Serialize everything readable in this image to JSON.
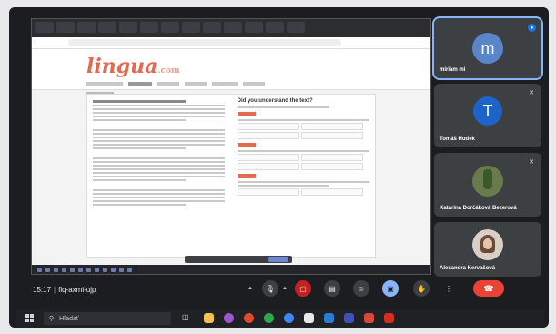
{
  "shared_screen": {
    "site_logo": "lingua",
    "site_logo_tld": ".com",
    "right_column_heading": "Did you understand the text?"
  },
  "participants": [
    {
      "name": "miriam mi",
      "initial": "m",
      "avatar_color": "#5a86c9",
      "speaking": true
    },
    {
      "name": "Tomáš Hudek",
      "initial": "T",
      "avatar_color": "#1e63c7",
      "speaking": false
    },
    {
      "name": "Katarína Dorčáková Bezerová",
      "initial": "",
      "avatar_color": "",
      "speaking": false
    },
    {
      "name": "Alexandra Kervašová",
      "initial": "",
      "avatar_color": "",
      "speaking": false
    }
  ],
  "meeting": {
    "time": "15:17",
    "code": "fiq-axmi-ujp"
  },
  "controls": {
    "icons": [
      "chevron-up-icon",
      "microphone-icon",
      "chevron-up-icon",
      "camera-off-icon",
      "captions-icon",
      "emoji-icon",
      "present-screen-icon",
      "raise-hand-icon",
      "more-options-icon",
      "end-call-icon"
    ]
  },
  "taskbar": {
    "search_placeholder": "Hľadať"
  },
  "colors": {
    "accent_red": "#ea4335",
    "logo": "#e26a50",
    "present_active": "#8ab4f8"
  }
}
